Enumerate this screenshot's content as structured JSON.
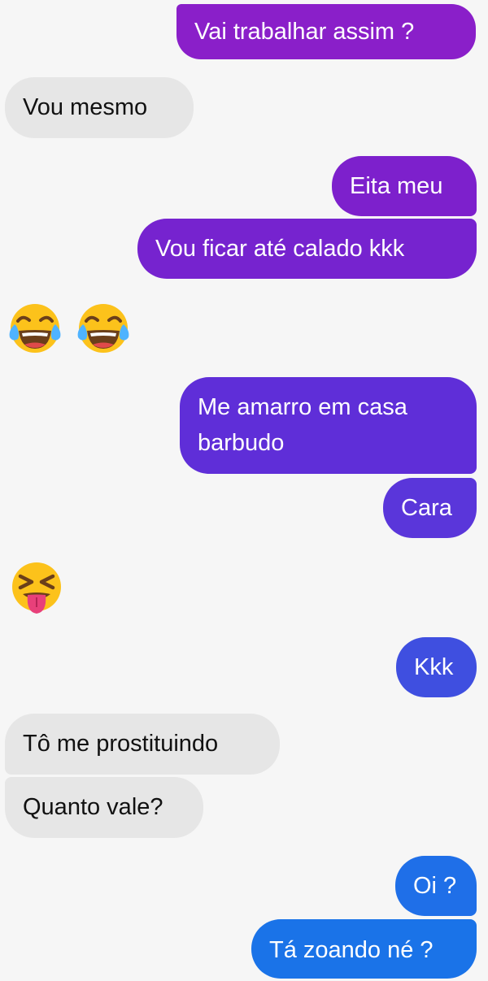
{
  "colors": {
    "sent_purple": "#8a1fc9",
    "sent_violet": "#6a2ed6",
    "sent_blue": "#3f4fe0",
    "sent_azure": "#1a73e8",
    "received_gray": "#e6e6e6",
    "background": "#f6f6f6"
  },
  "messages": [
    {
      "side": "sent",
      "text": "Vai trabalhar assim ?"
    },
    {
      "side": "received",
      "text": "Vou mesmo"
    },
    {
      "side": "sent",
      "text": "Eita meu"
    },
    {
      "side": "sent",
      "text": "Vou ficar até calado kkk"
    },
    {
      "side": "received",
      "emoji": [
        "face-with-tears-of-joy-icon",
        "face-with-tears-of-joy-icon"
      ]
    },
    {
      "side": "sent",
      "lines": [
        "Me amarro em casa",
        "barbudo"
      ]
    },
    {
      "side": "sent",
      "text": "Cara"
    },
    {
      "side": "received",
      "emoji": [
        "squinting-face-with-tongue-icon"
      ]
    },
    {
      "side": "sent",
      "text": "Kkk"
    },
    {
      "side": "received",
      "text": "Tô me prostituindo"
    },
    {
      "side": "received",
      "text": "Quanto vale?"
    },
    {
      "side": "sent",
      "text": "Oi ?"
    },
    {
      "side": "sent",
      "text": "Tá zoando né ?"
    }
  ]
}
